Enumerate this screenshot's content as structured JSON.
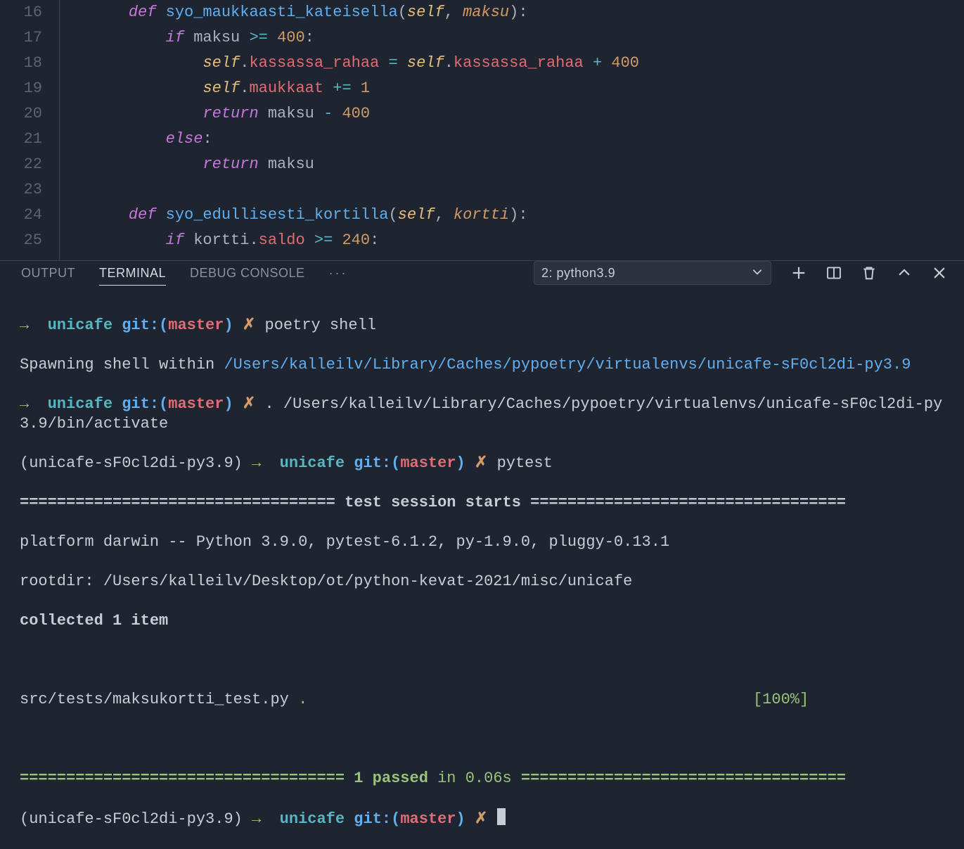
{
  "editor": {
    "lines": [
      {
        "n": 16,
        "tokens": [
          [
            "    ",
            ""
          ],
          [
            "def ",
            "kw"
          ],
          [
            "syo_maukkaasti_kateisella",
            "fn"
          ],
          [
            "(",
            "punc"
          ],
          [
            "self",
            "self"
          ],
          [
            ", ",
            "punc"
          ],
          [
            "maksu",
            "param"
          ],
          [
            "):",
            "punc"
          ]
        ]
      },
      {
        "n": 17,
        "tokens": [
          [
            "        ",
            ""
          ],
          [
            "if ",
            "kw"
          ],
          [
            "maksu ",
            "white"
          ],
          [
            ">=",
            "op"
          ],
          [
            " ",
            "white"
          ],
          [
            "400",
            "num"
          ],
          [
            ":",
            "punc"
          ]
        ]
      },
      {
        "n": 18,
        "tokens": [
          [
            "            ",
            ""
          ],
          [
            "self",
            "self"
          ],
          [
            ".",
            "punc"
          ],
          [
            "kassassa_rahaa",
            "prop"
          ],
          [
            " ",
            "white"
          ],
          [
            "=",
            "op"
          ],
          [
            " ",
            "white"
          ],
          [
            "self",
            "self"
          ],
          [
            ".",
            "punc"
          ],
          [
            "kassassa_rahaa",
            "prop"
          ],
          [
            " ",
            "white"
          ],
          [
            "+",
            "op"
          ],
          [
            " ",
            "white"
          ],
          [
            "400",
            "num"
          ]
        ]
      },
      {
        "n": 19,
        "tokens": [
          [
            "            ",
            ""
          ],
          [
            "self",
            "self"
          ],
          [
            ".",
            "punc"
          ],
          [
            "maukkaat",
            "prop"
          ],
          [
            " ",
            "white"
          ],
          [
            "+=",
            "op"
          ],
          [
            " ",
            "white"
          ],
          [
            "1",
            "num"
          ]
        ]
      },
      {
        "n": 20,
        "tokens": [
          [
            "            ",
            ""
          ],
          [
            "return ",
            "ret"
          ],
          [
            "maksu ",
            "white"
          ],
          [
            "-",
            "op"
          ],
          [
            " ",
            "white"
          ],
          [
            "400",
            "num"
          ]
        ]
      },
      {
        "n": 21,
        "tokens": [
          [
            "        ",
            ""
          ],
          [
            "else",
            "kw"
          ],
          [
            ":",
            "punc"
          ]
        ]
      },
      {
        "n": 22,
        "tokens": [
          [
            "            ",
            ""
          ],
          [
            "return ",
            "ret"
          ],
          [
            "maksu",
            "white"
          ]
        ]
      },
      {
        "n": 23,
        "tokens": [
          [
            "",
            ""
          ]
        ]
      },
      {
        "n": 24,
        "tokens": [
          [
            "    ",
            ""
          ],
          [
            "def ",
            "kw"
          ],
          [
            "syo_edullisesti_kortilla",
            "fn"
          ],
          [
            "(",
            "punc"
          ],
          [
            "self",
            "self"
          ],
          [
            ", ",
            "punc"
          ],
          [
            "kortti",
            "param"
          ],
          [
            "):",
            "punc"
          ]
        ]
      },
      {
        "n": 25,
        "tokens": [
          [
            "        ",
            ""
          ],
          [
            "if ",
            "kw"
          ],
          [
            "kortti",
            "white"
          ],
          [
            ".",
            "punc"
          ],
          [
            "saldo",
            "prop"
          ],
          [
            " ",
            "white"
          ],
          [
            ">=",
            "op"
          ],
          [
            " ",
            "white"
          ],
          [
            "240",
            "num"
          ],
          [
            ":",
            "punc"
          ]
        ]
      }
    ]
  },
  "panel": {
    "tabs": {
      "output": "OUTPUT",
      "terminal": "TERMINAL",
      "debug": "DEBUG CONSOLE"
    },
    "selector": "2: python3.9"
  },
  "terminal": {
    "arrow": "→",
    "project": "unicafe",
    "git_open": "git:(",
    "branch": "master",
    "git_close": ")",
    "dirty": "✗",
    "cmd1": "poetry shell",
    "spawn_pre": "Spawning shell within ",
    "spawn_path": "/Users/kalleilv/Library/Caches/pypoetry/virtualenvs/unicafe-sF0cl2di-py3.9",
    "cmd2": ". /Users/kalleilv/Library/Caches/pypoetry/virtualenvs/unicafe-sF0cl2di-py3.9/bin/activate",
    "venv": "(unicafe-sF0cl2di-py3.9)",
    "cmd3": "pytest",
    "rule1a": "================================== ",
    "rule1b": "test session starts",
    "rule1c": " ==================================",
    "platform": "platform darwin -- Python 3.9.0, pytest-6.1.2, py-1.9.0, pluggy-0.13.1",
    "rootdir": "rootdir: /Users/kalleilv/Desktop/ot/python-kevat-2021/misc/unicafe",
    "collected": "collected 1 item",
    "testfile": "src/tests/maksukortti_test.py ",
    "dot": ".",
    "progress_pad": "                                                ",
    "progress": "[100%]",
    "rule2a": "=================================== ",
    "rule2b": "1 passed",
    "rule2c": " in 0.06s",
    "rule2d": " ==================================="
  }
}
